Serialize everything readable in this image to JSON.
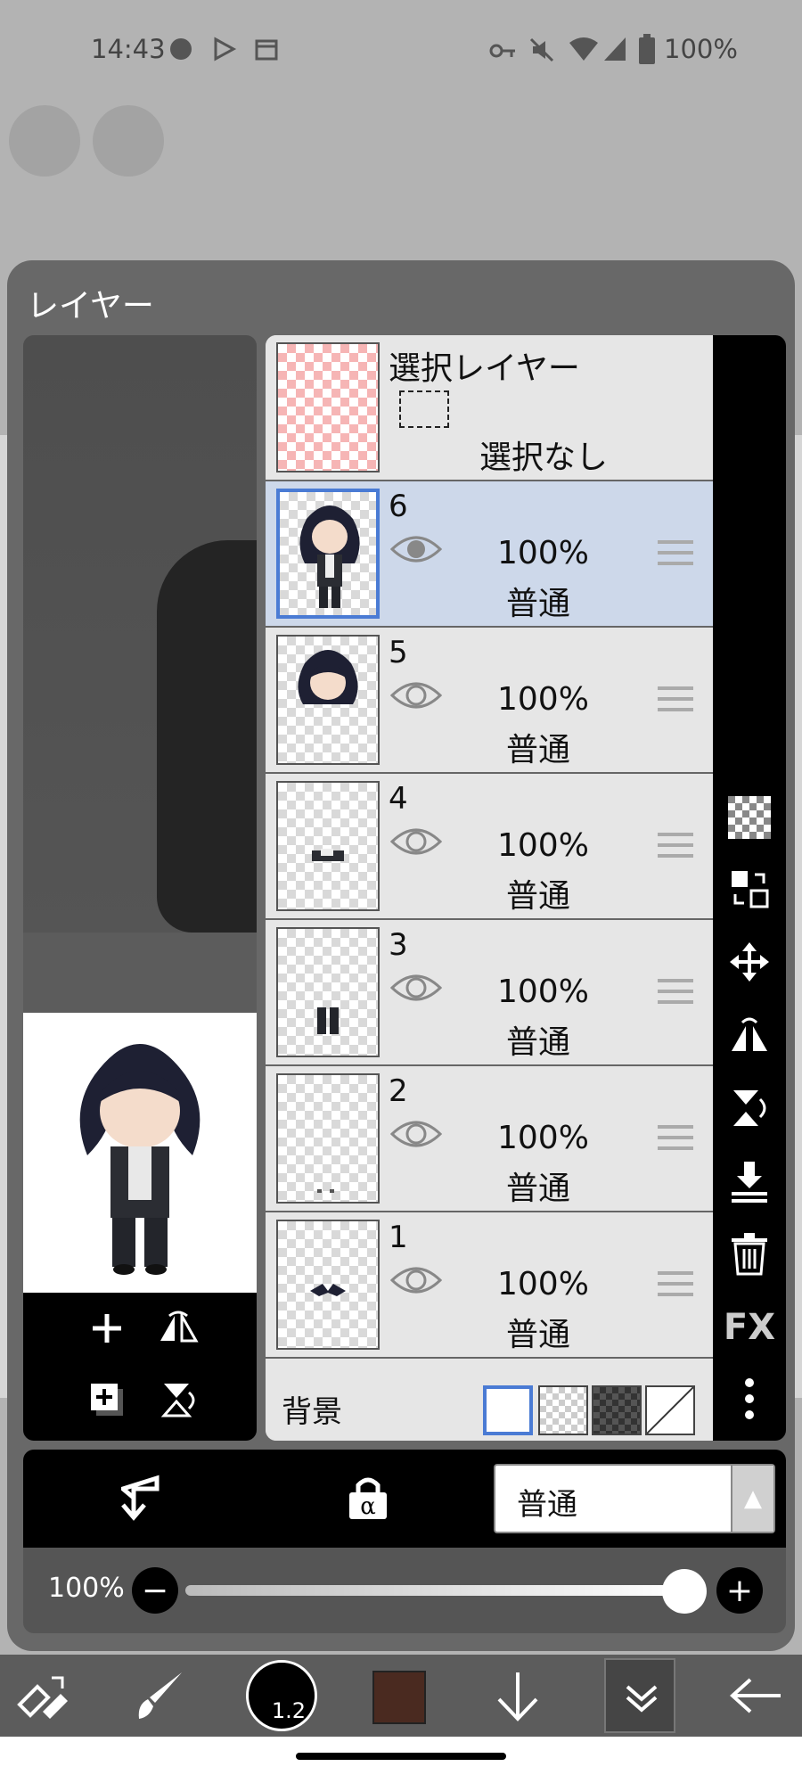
{
  "status_bar": {
    "time": "14:43",
    "battery": "100%",
    "icons": [
      "media-icon",
      "play-store-icon",
      "calendar-icon",
      "key-icon",
      "mute-icon",
      "wifi-icon",
      "signal-icon",
      "battery-icon"
    ]
  },
  "panel": {
    "title": "レイヤー",
    "selection_layer": {
      "title": "選択レイヤー",
      "status": "選択なし"
    },
    "layers": [
      {
        "number": "6",
        "opacity": "100%",
        "blend": "普通",
        "selected": true
      },
      {
        "number": "5",
        "opacity": "100%",
        "blend": "普通",
        "selected": false
      },
      {
        "number": "4",
        "opacity": "100%",
        "blend": "普通",
        "selected": false
      },
      {
        "number": "3",
        "opacity": "100%",
        "blend": "普通",
        "selected": false
      },
      {
        "number": "2",
        "opacity": "100%",
        "blend": "普通",
        "selected": false
      },
      {
        "number": "1",
        "opacity": "100%",
        "blend": "普通",
        "selected": false
      }
    ],
    "background": {
      "label": "背景"
    },
    "side_tools": [
      "checkerboard-icon",
      "layer-swap-icon",
      "move-icon",
      "flip-horizontal-icon",
      "flip-vertical-icon",
      "merge-down-icon",
      "trash-icon",
      "fx-button",
      "more-vert-icon"
    ],
    "fx_label": "FX",
    "blend_mode": "普通",
    "opacity_value": "100%",
    "opacity_level": 1.0
  },
  "toolbar": {
    "brush_size": "1.2",
    "color": "#4a2a20"
  }
}
